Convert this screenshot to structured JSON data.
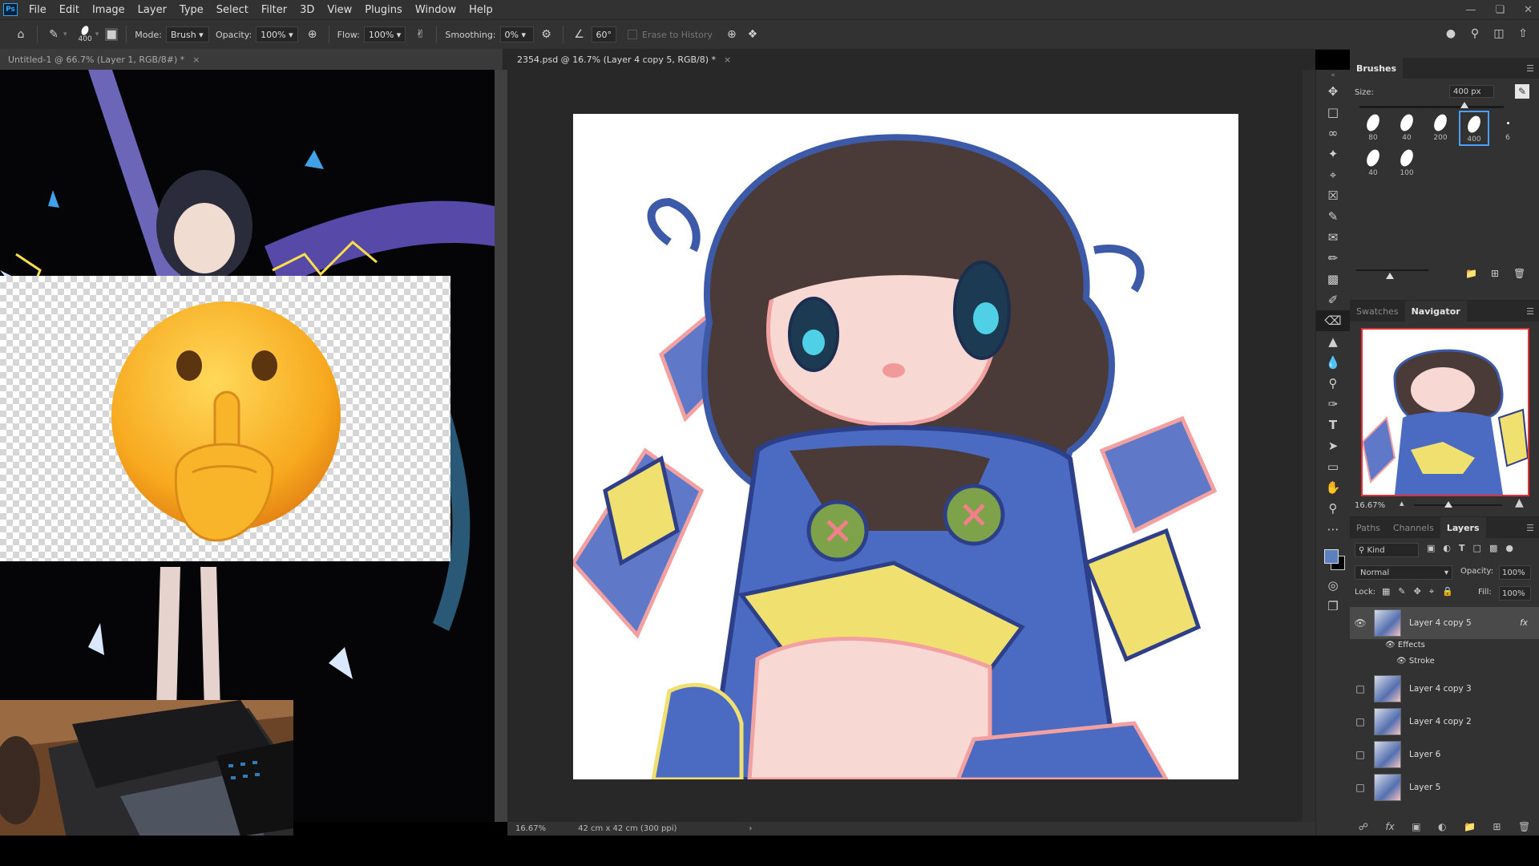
{
  "menubar": {
    "app_icon": "Ps",
    "items": [
      "File",
      "Edit",
      "Image",
      "Layer",
      "Type",
      "Select",
      "Filter",
      "3D",
      "View",
      "Plugins",
      "Window",
      "Help"
    ],
    "window_controls": [
      "minimize-icon",
      "restore-icon",
      "close-icon"
    ]
  },
  "options_bar": {
    "brush_size": "400",
    "mode_label": "Mode:",
    "mode_value": "Brush",
    "opacity_label": "Opacity:",
    "opacity_value": "100%",
    "flow_label": "Flow:",
    "flow_value": "100%",
    "smoothing_label": "Smoothing:",
    "smoothing_value": "0%",
    "angle_value": "60°",
    "erase_history_label": "Erase to History"
  },
  "tabs": [
    {
      "label": "Untitled-1 @ 66.7% (Layer 1, RGB/8#) *"
    },
    {
      "label": "2354.psd @ 16.7% (Layer 4 copy 5, RGB/8) *"
    }
  ],
  "status": {
    "zoom": "16.67%",
    "doc_size": "42 cm x 42 cm (300 ppi)"
  },
  "brushes_panel": {
    "title": "Brushes",
    "size_label": "Size:",
    "size_value": "400 px",
    "presets": [
      "80",
      "40",
      "200",
      "400",
      "6",
      "40",
      "100"
    ],
    "selected_preset": "400"
  },
  "navigator_panel": {
    "tabs": [
      "Swatches",
      "Navigator"
    ],
    "active_tab": "Navigator",
    "zoom": "16.67%"
  },
  "layers_panel": {
    "tabs": [
      "Paths",
      "Channels",
      "Layers"
    ],
    "active_tab": "Layers",
    "filter_label": "Kind",
    "blend_mode": "Normal",
    "opacity_label": "Opacity:",
    "opacity_value": "100%",
    "lock_label": "Lock:",
    "fill_label": "Fill:",
    "fill_value": "100%",
    "layers": [
      {
        "name": "Layer 4 copy 5",
        "visible": true,
        "selected": true,
        "fx": "fx"
      },
      {
        "name": "Layer 4 copy 3",
        "visible": false
      },
      {
        "name": "Layer 4 copy 2",
        "visible": false
      },
      {
        "name": "Layer 6",
        "visible": false
      },
      {
        "name": "Layer 5",
        "visible": false
      }
    ],
    "effects_label": "Effects",
    "effect_items": [
      "Stroke"
    ]
  },
  "colors": {
    "foreground": "#5b7fbf",
    "background": "#000000",
    "ui_dark": "#323232"
  }
}
